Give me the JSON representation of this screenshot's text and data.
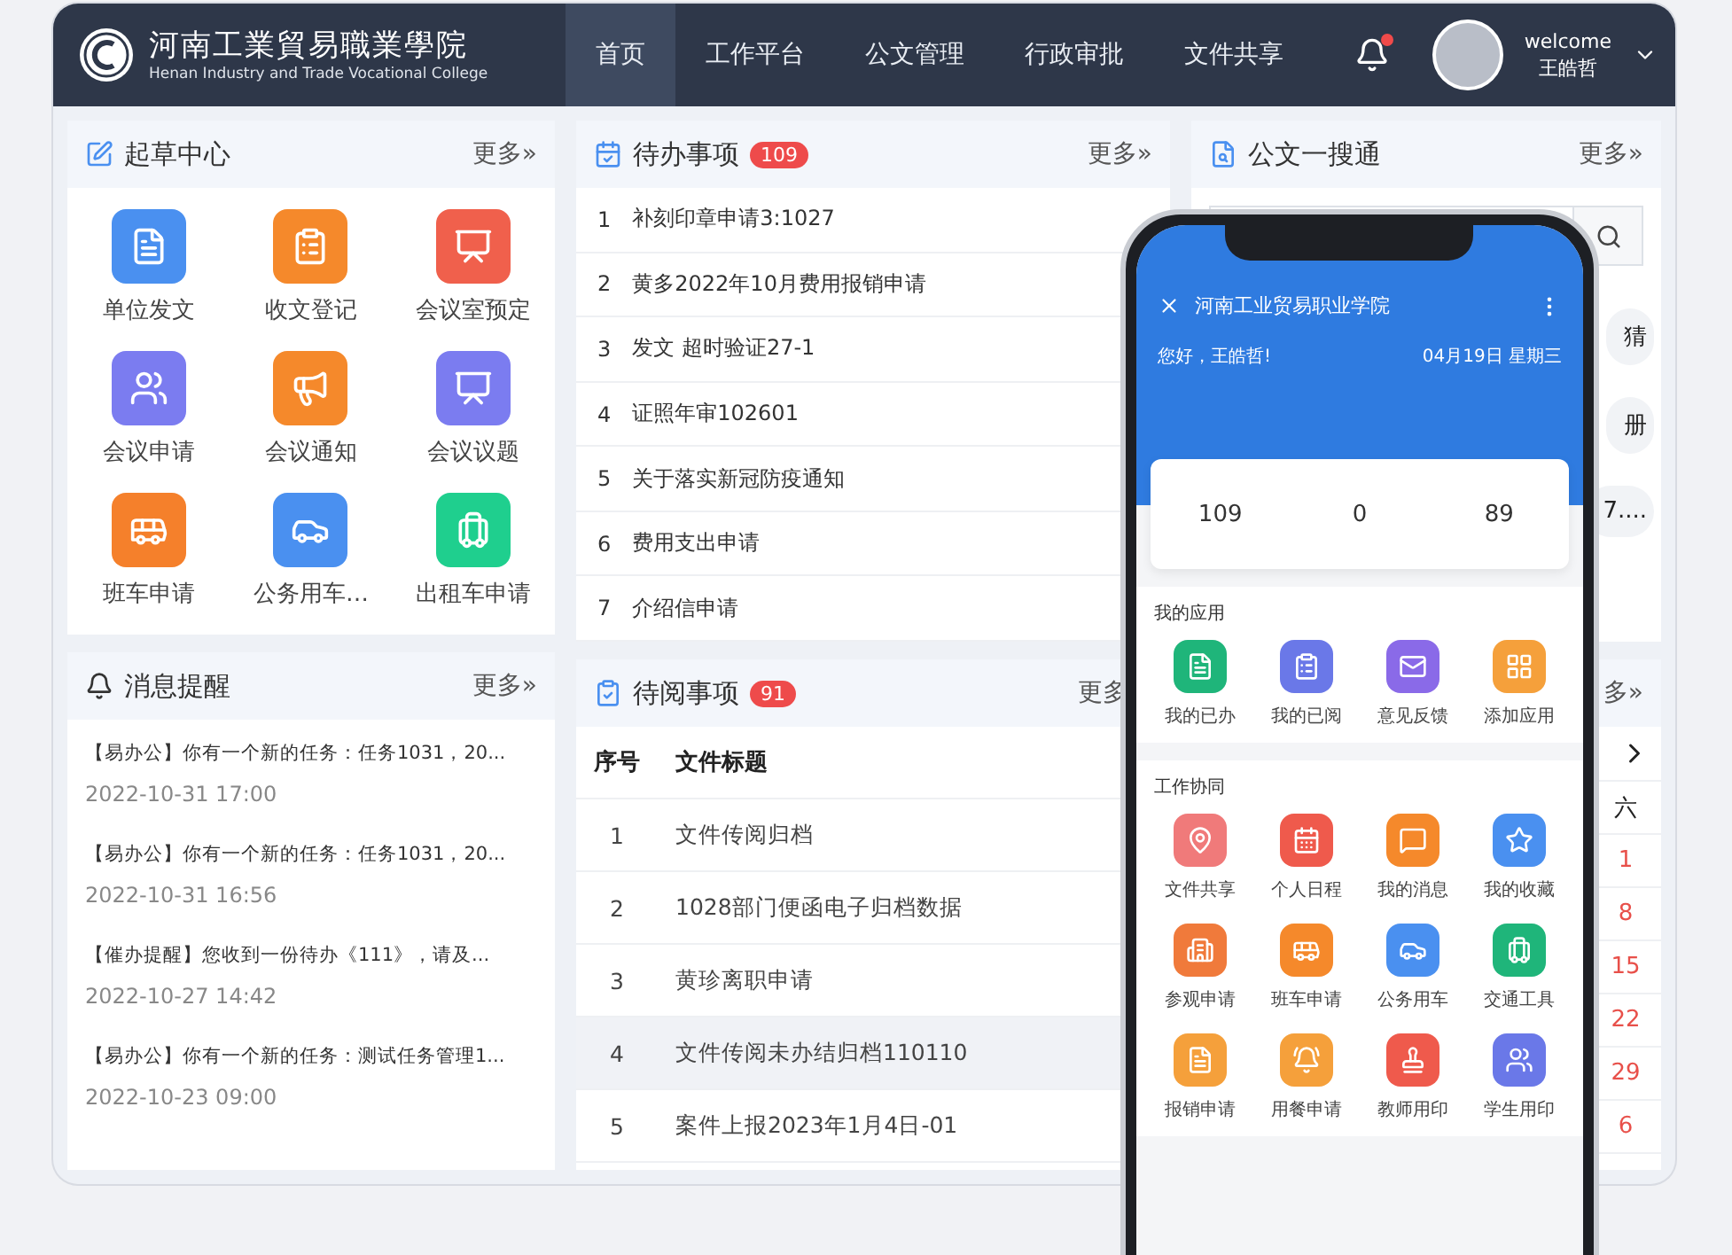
{
  "header": {
    "logo_title": "河南工業貿易職業學院",
    "logo_subtitle": "Henan Industry and Trade Vocational College",
    "nav": [
      {
        "label": "首页",
        "selected": true
      },
      {
        "label": "工作平台",
        "selected": false
      },
      {
        "label": "公文管理",
        "selected": false
      },
      {
        "label": "行政审批",
        "selected": false
      },
      {
        "label": "文件共享",
        "selected": false
      }
    ],
    "has_notification": true,
    "user": {
      "greeting": "welcome",
      "name": "王皓哲"
    }
  },
  "drafting": {
    "title": "起草中心",
    "more": "更多»",
    "apps": [
      {
        "label": "单位发文",
        "color": "#4a90f0",
        "kind": "doc"
      },
      {
        "label": "收文登记",
        "color": "#f5892b",
        "kind": "form"
      },
      {
        "label": "会议室预定",
        "color": "#f0604c",
        "kind": "board"
      },
      {
        "label": "会议申请",
        "color": "#7b7cf0",
        "kind": "people"
      },
      {
        "label": "会议通知",
        "color": "#f5892b",
        "kind": "megaphone"
      },
      {
        "label": "会议议题",
        "color": "#7b7cf0",
        "kind": "board"
      },
      {
        "label": "班车申请",
        "color": "#f5802b",
        "kind": "bus"
      },
      {
        "label": "公务用车…",
        "color": "#4a90f0",
        "kind": "car"
      },
      {
        "label": "出租车申请",
        "color": "#1fcf8e",
        "kind": "luggage"
      }
    ]
  },
  "todo": {
    "title": "待办事项",
    "badge": "109",
    "more": "更多»",
    "items": [
      {
        "index": "1",
        "title": "补刻印章申请3:1027"
      },
      {
        "index": "2",
        "title": "黄多2022年10月费用报销申请"
      },
      {
        "index": "3",
        "title": "发文 超时验证27-1"
      },
      {
        "index": "4",
        "title": "证照年审102601"
      },
      {
        "index": "5",
        "title": "关于落实新冠防疫通知"
      },
      {
        "index": "6",
        "title": "费用支出申请"
      },
      {
        "index": "7",
        "title": "介绍信申请"
      }
    ]
  },
  "search": {
    "title": "公文一搜通",
    "more": "更多»",
    "tags": [
      "猜",
      "册",
      "7...."
    ]
  },
  "messages": {
    "title": "消息提醒",
    "more": "更多»",
    "items": [
      {
        "text": "【易办公】你有一个新的任务：任务1031，20...",
        "time": "2022-10-31 17:00"
      },
      {
        "text": "【易办公】你有一个新的任务：任务1031，20...",
        "time": "2022-10-31 16:56"
      },
      {
        "text": "【催办提醒】您收到一份待办《111》，请及...",
        "time": "2022-10-27 14:42"
      },
      {
        "text": "【易办公】你有一个新的任务：测试任务管理1...",
        "time": "2022-10-23 09:00"
      }
    ]
  },
  "to_read": {
    "title": "待阅事项",
    "badge": "91",
    "more": "更多",
    "columns": [
      "序号",
      "文件标题"
    ],
    "rows": [
      {
        "index": "1",
        "title": "文件传阅归档",
        "selected": false
      },
      {
        "index": "2",
        "title": "1028部门便函电子归档数据",
        "selected": false
      },
      {
        "index": "3",
        "title": "黄珍离职申请",
        "selected": false
      },
      {
        "index": "4",
        "title": "文件传阅未办结归档110110",
        "selected": true
      },
      {
        "index": "5",
        "title": "案件上报2023年1月4日-01",
        "selected": false
      }
    ]
  },
  "calendar": {
    "more": "多»",
    "weekday": "六",
    "days": [
      "1",
      "8",
      "15",
      "22",
      "29",
      "6"
    ]
  },
  "phone": {
    "title": "河南工业贸易职业学院",
    "date": "04月19日 星期三",
    "greeting": "您好，王皓哲!",
    "stats": [
      "109",
      "0",
      "89"
    ],
    "sections": [
      {
        "title": "我的应用",
        "apps": [
          {
            "label": "我的已办",
            "color": "#1fb57a",
            "kind": "doc"
          },
          {
            "label": "我的已阅",
            "color": "#6a78e8",
            "kind": "form"
          },
          {
            "label": "意见反馈",
            "color": "#8a6ae8",
            "kind": "mail"
          },
          {
            "label": "添加应用",
            "color": "#f5a03b",
            "kind": "grid"
          }
        ]
      },
      {
        "title": "工作协同",
        "apps": [
          {
            "label": "文件共享",
            "color": "#f07a7a",
            "kind": "pin"
          },
          {
            "label": "个人日程",
            "color": "#ef5a4c",
            "kind": "calendar"
          },
          {
            "label": "我的消息",
            "color": "#f5892b",
            "kind": "message"
          },
          {
            "label": "我的收藏",
            "color": "#4a90f0",
            "kind": "star"
          },
          {
            "label": "参观申请",
            "color": "#f07a3b",
            "kind": "building"
          },
          {
            "label": "班车申请",
            "color": "#f5892b",
            "kind": "bus"
          },
          {
            "label": "公务用车",
            "color": "#4a90f0",
            "kind": "car"
          },
          {
            "label": "交通工具",
            "color": "#1fb57a",
            "kind": "luggage"
          },
          {
            "label": "报销申请",
            "color": "#f5a03b",
            "kind": "doc"
          },
          {
            "label": "用餐申请",
            "color": "#f5a03b",
            "kind": "bell"
          },
          {
            "label": "教师用印",
            "color": "#ef5a4c",
            "kind": "stamp"
          },
          {
            "label": "学生用印",
            "color": "#6a78e8",
            "kind": "people"
          }
        ]
      }
    ]
  }
}
